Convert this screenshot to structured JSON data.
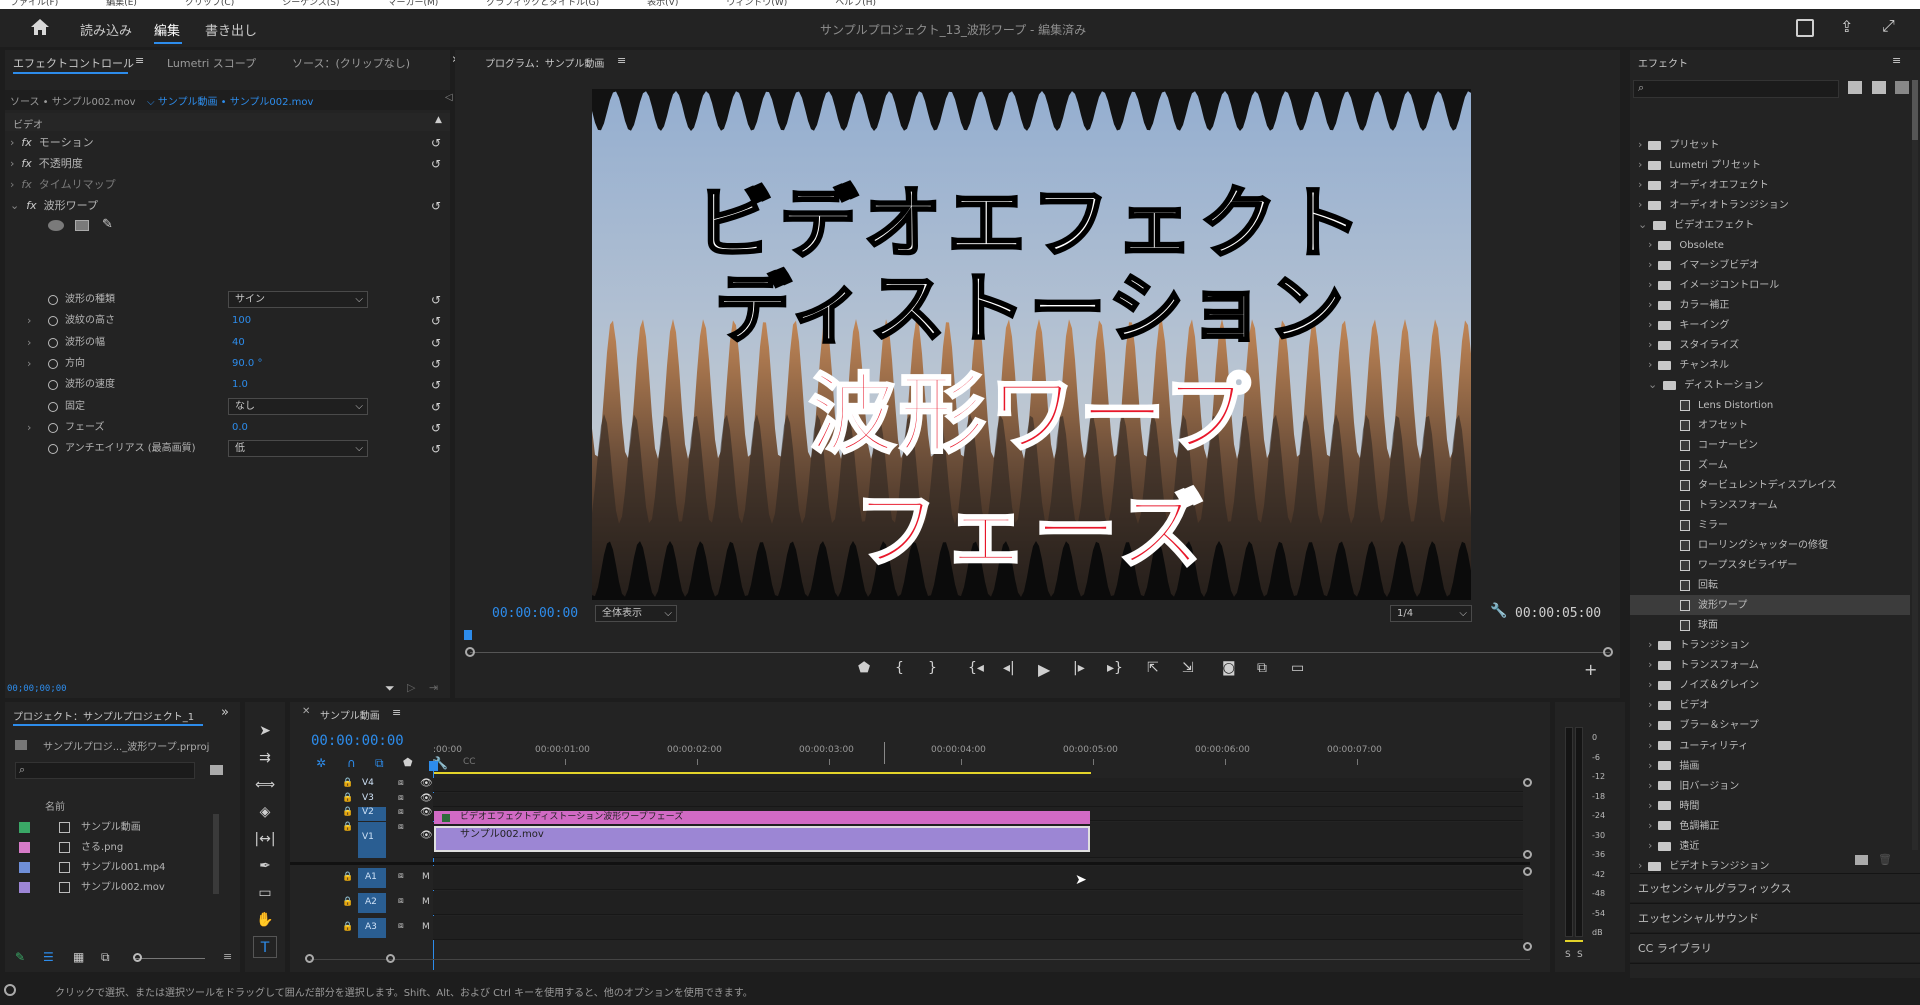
{
  "menubar": {
    "items": [
      "ファイル(F)",
      "編集(E)",
      "クリップ(C)",
      "シーケンス(S)",
      "マーカー(M)",
      "グラフィックとタイトル(G)",
      "表示(V)",
      "ウィンドウ(W)",
      "ヘルプ(H)"
    ]
  },
  "header": {
    "tabs": [
      {
        "label": "読み込み"
      },
      {
        "label": "編集"
      },
      {
        "label": "書き出し"
      }
    ],
    "title": "サンプルプロジェクト_13_波形ワープ",
    "saved": " - 編集済み"
  },
  "effect_controls": {
    "tabs": [
      "エフェクトコントロール",
      "Lumetri スコープ",
      "ソース：(クリップなし)"
    ],
    "source": "ソース • サンプル002.mov",
    "sequence": "サンプル動画 • サンプル002.mov",
    "section": "ビデオ",
    "effects": [
      "モーション",
      "不透明度",
      "タイムリマップ",
      "波形ワープ"
    ],
    "params": [
      {
        "label": "波形の種類",
        "value": "サイン",
        "kind": "select"
      },
      {
        "label": "波紋の高さ",
        "value": "100",
        "kind": "num"
      },
      {
        "label": "波形の幅",
        "value": "40",
        "kind": "num"
      },
      {
        "label": "方向",
        "value": "90.0 °",
        "kind": "num"
      },
      {
        "label": "波形の速度",
        "value": "1.0",
        "kind": "num"
      },
      {
        "label": "固定",
        "value": "なし",
        "kind": "select"
      },
      {
        "label": "フェーズ",
        "value": "0.0",
        "kind": "num"
      },
      {
        "label": "アンチエイリアス (最高画質)",
        "value": "低",
        "kind": "select"
      }
    ],
    "timecode": "00;00;00;00"
  },
  "program": {
    "title": "プログラム：サンプル動画",
    "timecode": "00:00:00:00",
    "fit": "全体表示",
    "quality": "1/4",
    "duration": "00:00:05:00",
    "overlay": {
      "line1": "ビデオエフェクト",
      "line2": "ディストーション",
      "line3": "波形ワープ",
      "line4": "フェーズ"
    }
  },
  "effects_panel": {
    "title": "エフェクト",
    "top": [
      "プリセット",
      "Lumetri プリセット",
      "オーディオエフェクト",
      "オーディオトランジション",
      "ビデオエフェクト"
    ],
    "video": [
      "Obsolete",
      "イマーシブビデオ",
      "イメージコントロール",
      "カラー補正",
      "キーイング",
      "スタイライズ",
      "チャンネル",
      "ディストーション"
    ],
    "distortion": [
      "Lens Distortion",
      "オフセット",
      "コーナーピン",
      "ズーム",
      "タービュレントディスプレイス",
      "トランスフォーム",
      "ミラー",
      "ローリングシャッターの修復",
      "ワープスタビライザー",
      "回転",
      "波形ワープ",
      "球面"
    ],
    "video_rest": [
      "トランジション",
      "トランスフォーム",
      "ノイズ＆グレイン",
      "ビデオ",
      "ブラー＆シャープ",
      "ユーティリティ",
      "描画",
      "旧バージョン",
      "時間",
      "色調補正",
      "遠近"
    ],
    "last": "ビデオトランジション",
    "sections": [
      "エッセンシャルグラフィックス",
      "エッセンシャルサウンド",
      "CC ライブラリ"
    ]
  },
  "project": {
    "title": "プロジェクト：サンプルプロジェクト_1",
    "path": "サンプルプロジ..._波形ワープ.prproj",
    "col": "名前",
    "items": [
      {
        "name": "サンプル動画",
        "color": "#3aa866"
      },
      {
        "name": "さる.png",
        "color": "#d77bc8"
      },
      {
        "name": "サンプル001.mp4",
        "color": "#6f8fd8"
      },
      {
        "name": "サンプル002.mov",
        "color": "#9d86d6"
      }
    ]
  },
  "timeline": {
    "title": "サンプル動画",
    "timecode": "00:00:00:00",
    "ruler": [
      ":00:00",
      "00:00:01:00",
      "00:00:02:00",
      "00:00:03:00",
      "00:00:04:00",
      "00:00:05:00",
      "00:00:06:00",
      "00:00:07:00"
    ],
    "video_tracks": [
      "V4",
      "V3",
      "V2",
      "V1"
    ],
    "audio_tracks": [
      "A1",
      "A2",
      "A3"
    ],
    "clip_title": "ビデオエフェクトディストーション波形ワープフェーズ",
    "clip_video": "サンプル002.mov"
  },
  "meter": {
    "scale": [
      "0",
      "-6",
      "-12",
      "-18",
      "-24",
      "-30",
      "-36",
      "-42",
      "-48",
      "-54",
      "dB"
    ],
    "solo": "S"
  },
  "status": "クリックで選択、または選択ツールをドラッグして囲んだ部分を選択します。Shift、Alt、および Ctrl キーを使用すると、他のオプションを使用できます。",
  "colors": {
    "accent": "#2d8ceb",
    "clip_title": "#d16ac4",
    "clip_video": "#9c86d4",
    "overlay_red": "#e8172a"
  }
}
